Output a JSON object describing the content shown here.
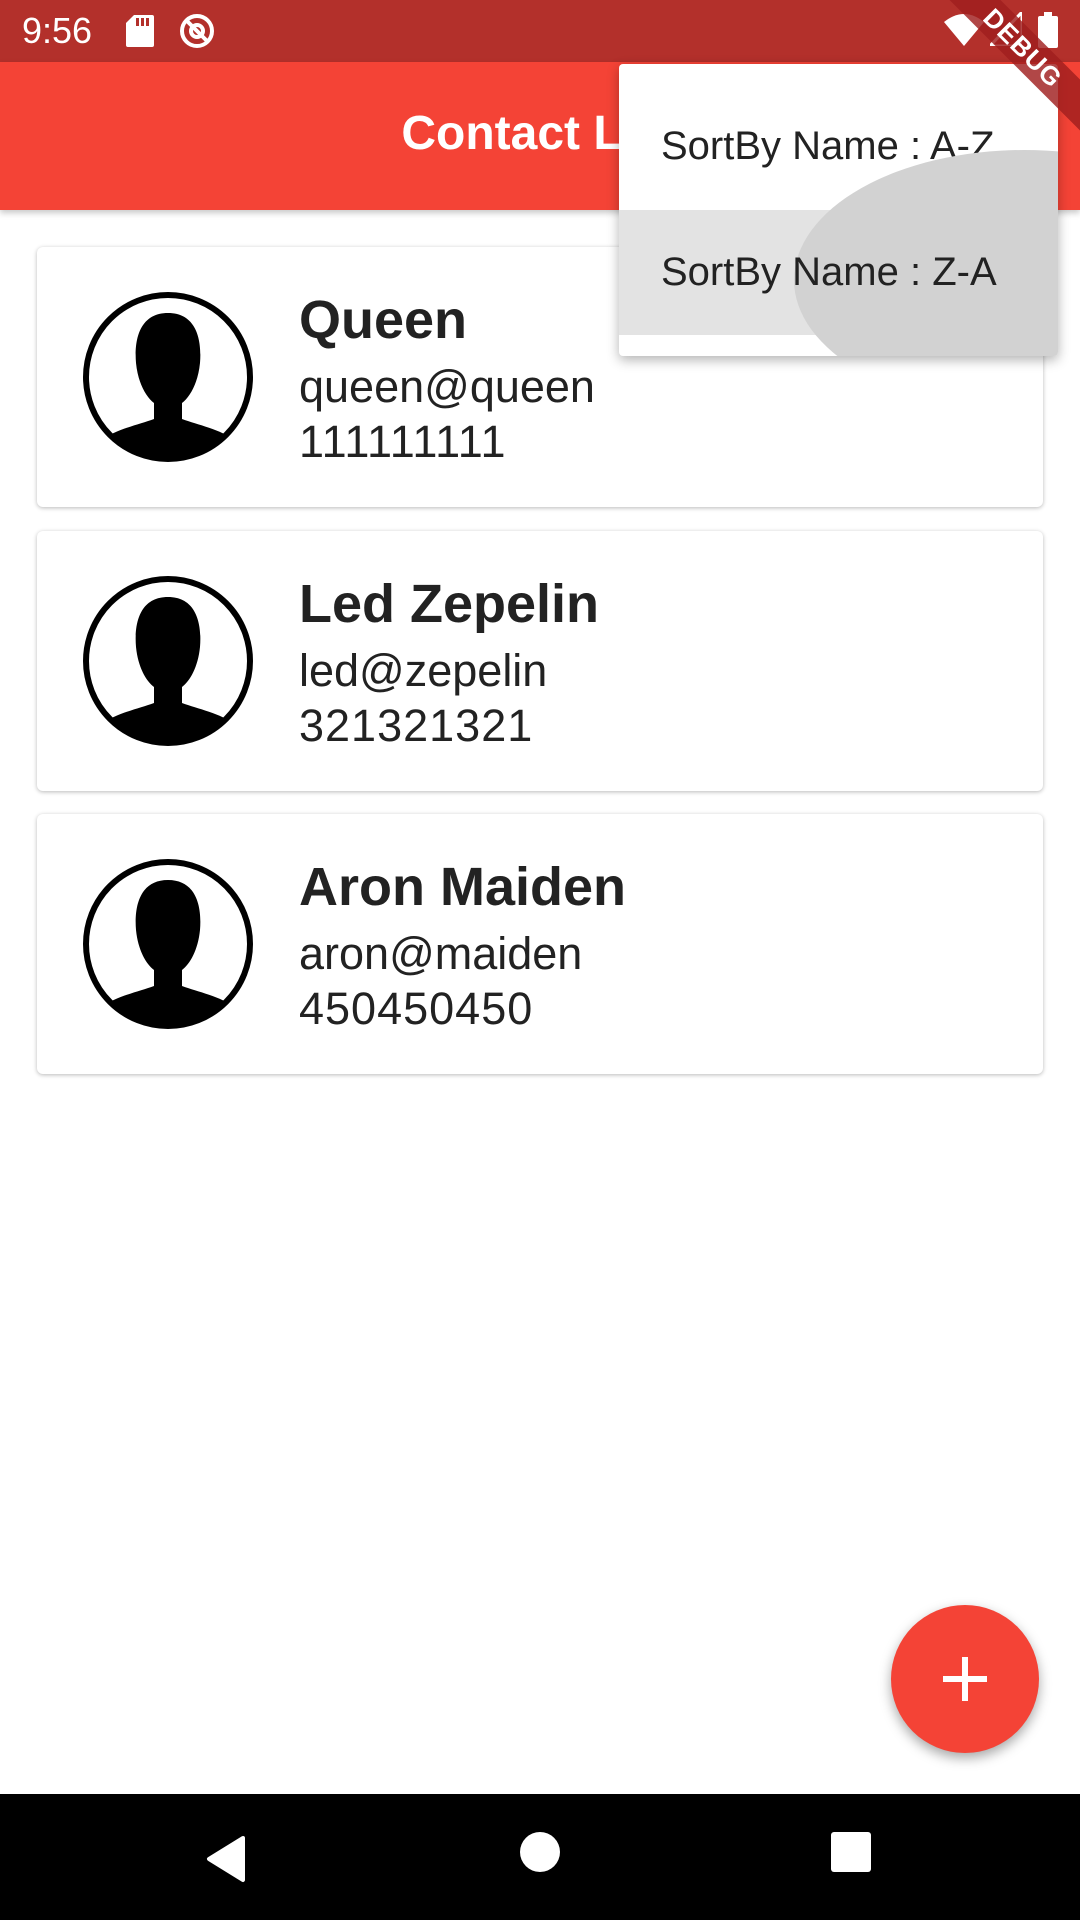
{
  "status_bar": {
    "time": "9:56",
    "icons": [
      "sd-card-icon",
      "sync-icon",
      "wifi-icon",
      "signal-icon",
      "battery-icon"
    ]
  },
  "debug_banner": "DEBUG",
  "app_bar": {
    "title": "Contact List",
    "color": "#f44336"
  },
  "sort_menu": {
    "items": [
      {
        "label": "SortBy Name : A-Z"
      },
      {
        "label": "SortBy Name : Z-A"
      }
    ]
  },
  "contacts": [
    {
      "name": "Queen",
      "email": "queen@queen",
      "phone": "111111111",
      "avatar_icon": "person-avatar-icon"
    },
    {
      "name": "Led Zepelin",
      "email": "led@zepelin",
      "phone": "321321321",
      "avatar_icon": "person-avatar-icon"
    },
    {
      "name": "Aron Maiden",
      "email": "aron@maiden",
      "phone": "450450450",
      "avatar_icon": "person-avatar-icon"
    }
  ],
  "fab": {
    "icon": "plus-icon",
    "color": "#f44336"
  },
  "nav_bar": {
    "icons": [
      "back-icon",
      "home-icon",
      "recents-icon"
    ]
  }
}
